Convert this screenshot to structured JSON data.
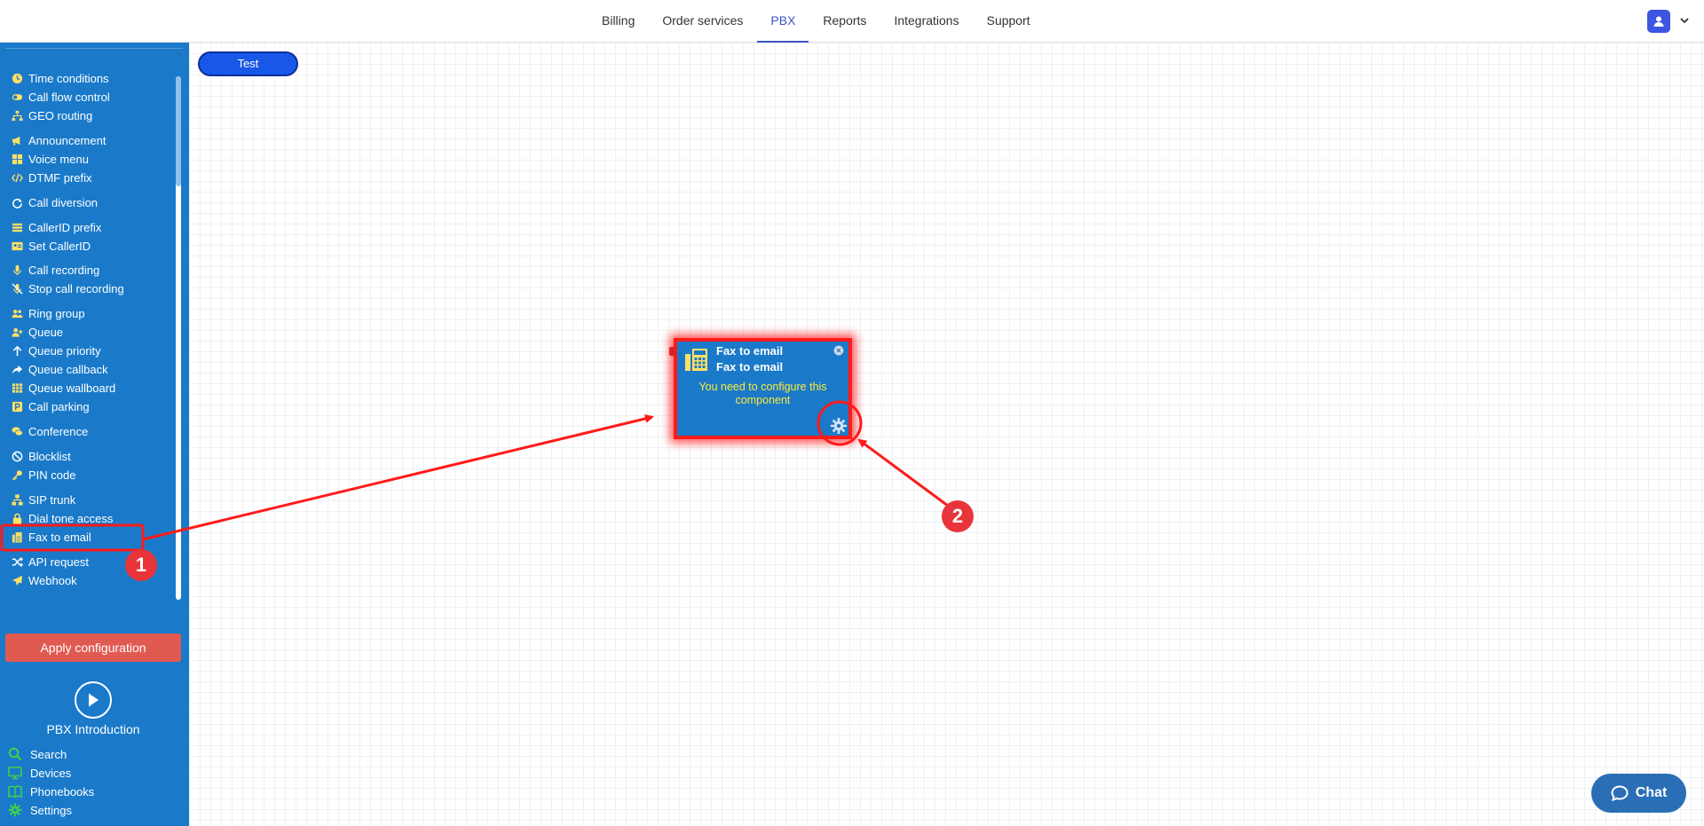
{
  "topnav": {
    "tabs": [
      {
        "label": "Billing"
      },
      {
        "label": "Order services"
      },
      {
        "label": "PBX",
        "active": true
      },
      {
        "label": "Reports"
      },
      {
        "label": "Integrations"
      },
      {
        "label": "Support"
      }
    ],
    "accent_color": "#3c56c8"
  },
  "sidebar": {
    "background": "#1a7ac9",
    "items": [
      {
        "label": "Time conditions",
        "icon": "clock-icon"
      },
      {
        "label": "Call flow control",
        "icon": "toggle-icon"
      },
      {
        "label": "GEO routing",
        "icon": "sitemap-icon"
      },
      {
        "label": "Announcement",
        "icon": "megaphone-icon"
      },
      {
        "label": "Voice menu",
        "icon": "grid-icon"
      },
      {
        "label": "DTMF prefix",
        "icon": "code-icon"
      },
      {
        "label": "Call diversion",
        "icon": "redo-icon"
      },
      {
        "label": "CallerID prefix",
        "icon": "list-icon"
      },
      {
        "label": "Set CallerID",
        "icon": "id-card-icon"
      },
      {
        "label": "Call recording",
        "icon": "microphone-icon"
      },
      {
        "label": "Stop call recording",
        "icon": "microphone-slash-icon"
      },
      {
        "label": "Ring group",
        "icon": "users-icon"
      },
      {
        "label": "Queue",
        "icon": "user-plus-icon"
      },
      {
        "label": "Queue priority",
        "icon": "arrow-up-icon"
      },
      {
        "label": "Queue callback",
        "icon": "share-icon"
      },
      {
        "label": "Queue wallboard",
        "icon": "table-icon"
      },
      {
        "label": "Call parking",
        "icon": "parking-icon"
      },
      {
        "label": "Conference",
        "icon": "comments-icon"
      },
      {
        "label": "Blocklist",
        "icon": "ban-icon"
      },
      {
        "label": "PIN code",
        "icon": "key-icon"
      },
      {
        "label": "SIP trunk",
        "icon": "network-icon"
      },
      {
        "label": "Dial tone access",
        "icon": "lock-icon"
      },
      {
        "label": "Fax to email",
        "icon": "fax-icon"
      },
      {
        "label": "API request",
        "icon": "random-icon"
      },
      {
        "label": "Webhook",
        "icon": "paper-plane-icon"
      }
    ],
    "apply_label": "Apply configuration",
    "intro_label": "PBX Introduction",
    "bottom": [
      {
        "label": "Search",
        "icon": "search-icon"
      },
      {
        "label": "Devices",
        "icon": "monitor-icon"
      },
      {
        "label": "Phonebooks",
        "icon": "book-icon"
      },
      {
        "label": "Settings",
        "icon": "gear-icon"
      }
    ]
  },
  "canvas": {
    "test_label": "Test",
    "component": {
      "title": "Fax to email",
      "subtitle": "Fax to email",
      "message": "You need to configure this component"
    }
  },
  "annotations": {
    "badge1": "1",
    "badge2": "2",
    "color": "#e8343a"
  },
  "chat": {
    "label": "Chat"
  }
}
